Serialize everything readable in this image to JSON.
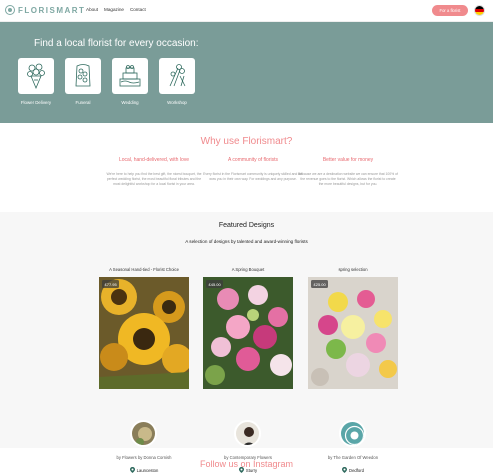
{
  "nav": {
    "logo": "FLORISMART",
    "links": [
      "About",
      "Magazine",
      "Contact"
    ],
    "cta": "For a florist",
    "flag_colors": [
      "#000000",
      "#dd0000",
      "#ffce00"
    ]
  },
  "hero": {
    "title": "Find a local florist for every occasion:",
    "occasions": [
      {
        "label": "Flower Delivery",
        "icon": "bouquet-icon"
      },
      {
        "label": "Funeral",
        "icon": "wreath-icon"
      },
      {
        "label": "Wedding",
        "icon": "wedding-cake-icon"
      },
      {
        "label": "Workshop",
        "icon": "florist-tools-icon"
      }
    ],
    "bg_color": "#7a9c98"
  },
  "why": {
    "title": "Why use Florismart?",
    "columns": [
      {
        "heading": "Local, hand-delivered, with love",
        "text": "We're here to help you find the best gift, the nicest bouquet, the perfect wedding florist, the most beautiful floral tributes and the most delightful workshop for a local florist in your area."
      },
      {
        "heading": "A community of florists",
        "text": "Every florist in the Florismart community is uniquely skilled and will wow you in their own way. For weddings and any purpose."
      },
      {
        "heading": "Better value for money",
        "text": "Because we are a destination website we can ensure that 100% of the revenue goes to the florist. Which allows the florist to create the more beautiful designs, but for you."
      }
    ]
  },
  "featured": {
    "title": "Featured Designs",
    "subtitle": "A selection of designs by talented and award-winning florists",
    "cards": [
      {
        "title": "A Seasonal Hand-tied - Florist Choice",
        "price": "£77.95",
        "by": "by Flowers by Donna Cornish",
        "location": "Launceston"
      },
      {
        "title": "A Spring Bouquet",
        "price": "£45.00",
        "by": "by Contemporary Flowers",
        "location": "Sturry"
      },
      {
        "title": "spring selection",
        "price": "£25.00",
        "by": "by The Garden Of Weedon",
        "location": "Dedford"
      }
    ]
  },
  "instagram": {
    "title": "Follow us on Instagram"
  },
  "colors": {
    "accent": "#f08a8d",
    "teal": "#7a9c98"
  }
}
